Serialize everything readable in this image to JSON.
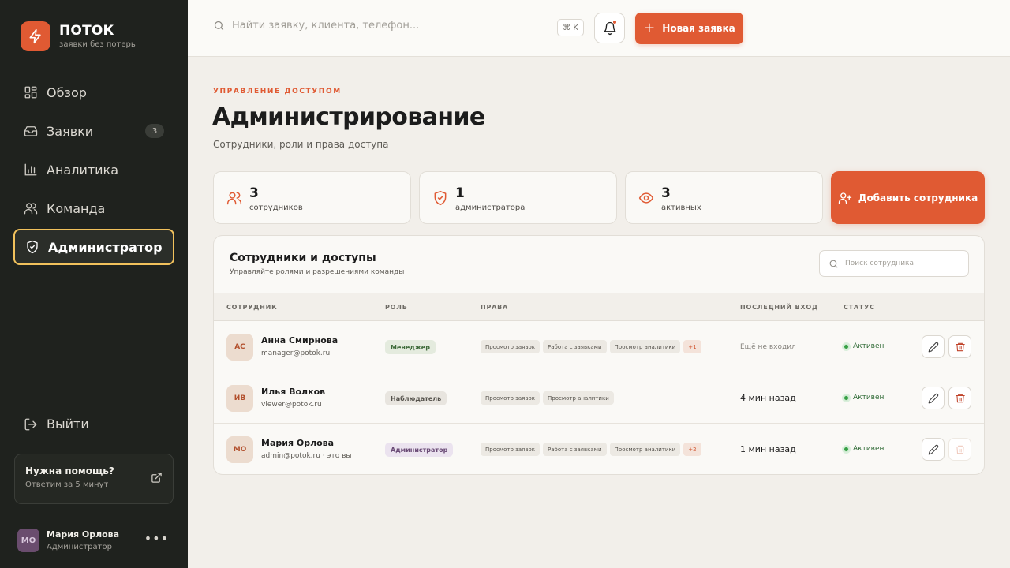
{
  "brand": {
    "name": "ПОТОК",
    "tagline": "заявки без потерь"
  },
  "sidebar": {
    "items": [
      {
        "label": "Обзор",
        "icon": "grid-icon"
      },
      {
        "label": "Заявки",
        "icon": "inbox-icon",
        "badge": "3"
      },
      {
        "label": "Аналитика",
        "icon": "bar-chart-icon"
      },
      {
        "label": "Команда",
        "icon": "users-icon"
      },
      {
        "label": "Администратор",
        "icon": "shield-check-icon",
        "active": true
      }
    ],
    "logout": "Выйти",
    "help": {
      "title": "Нужна помощь?",
      "subtitle": "Ответим за 5 минут"
    },
    "user": {
      "initials": "МО",
      "name": "Мария Орлова",
      "role": "Администратор"
    }
  },
  "header": {
    "search_placeholder": "Найти заявку, клиента, телефон...",
    "shortcut": "⌘ K",
    "new_request": "Новая заявка"
  },
  "page": {
    "eyebrow": "УПРАВЛЕНИЕ ДОСТУПОМ",
    "title": "Администрирование",
    "subtitle": "Сотрудники, роли и права доступа"
  },
  "stats": [
    {
      "value": "3",
      "label": "сотрудников",
      "icon": "users-icon"
    },
    {
      "value": "1",
      "label": "администратора",
      "icon": "shield-check-icon"
    },
    {
      "value": "3",
      "label": "активных",
      "icon": "eye-icon"
    }
  ],
  "add_employee": "Добавить сотрудника",
  "table": {
    "title": "Сотрудники и доступы",
    "subtitle": "Управляйте ролями и разрешениями команды",
    "search_placeholder": "Поиск сотрудника",
    "columns": [
      "СОТРУДНИК",
      "РОЛЬ",
      "ПРАВА",
      "ПОСЛЕДНИЙ ВХОД",
      "СТАТУС"
    ],
    "rows": [
      {
        "initials": "АС",
        "name": "Анна Смирнова",
        "email": "manager@potok.ru",
        "role": "Менеджер",
        "perms": [
          "Просмотр заявок",
          "Работа с заявками",
          "Просмотр аналитики"
        ],
        "more": "+1",
        "last_login": "Ещё не входил",
        "status": "Активен"
      },
      {
        "initials": "ИВ",
        "name": "Илья Волков",
        "email": "viewer@potok.ru",
        "role": "Наблюдатель",
        "perms": [
          "Просмотр заявок",
          "Просмотр аналитики"
        ],
        "more": "",
        "last_login": "4 мин назад",
        "status": "Активен"
      },
      {
        "initials": "МО",
        "name": "Мария Орлова",
        "email": "admin@potok.ru · это вы",
        "role": "Администратор",
        "perms": [
          "Просмотр заявок",
          "Работа с заявками",
          "Просмотр аналитики"
        ],
        "more": "+2",
        "last_login": "1 мин назад",
        "status": "Активен"
      }
    ]
  },
  "colors": {
    "accent": "#e05a33",
    "sidebar": "#1f221e",
    "active_outline": "#f1c15c",
    "status_active": "#36a145"
  }
}
